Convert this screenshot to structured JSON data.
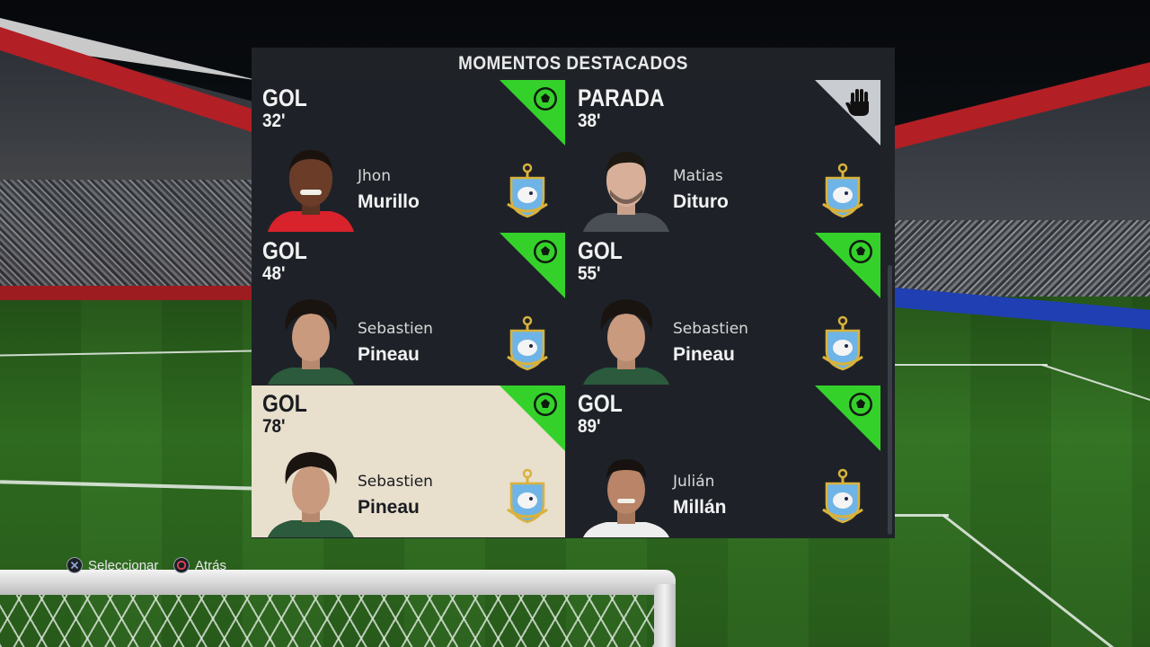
{
  "panel": {
    "title": "MOMENTOS DESTACADOS"
  },
  "highlights": [
    {
      "event": "GOL",
      "minute": "32'",
      "first_name": "Jhon",
      "last_name": "Murillo",
      "type_icon": "soccer-ball-icon",
      "corner_color": "#35d12b",
      "selected": false
    },
    {
      "event": "PARADA",
      "minute": "38'",
      "first_name": "Matias",
      "last_name": "Dituro",
      "type_icon": "goalkeeper-glove-icon",
      "corner_color": "#c9ccd0",
      "selected": false
    },
    {
      "event": "GOL",
      "minute": "48'",
      "first_name": "Sebastien",
      "last_name": "Pineau",
      "type_icon": "soccer-ball-icon",
      "corner_color": "#35d12b",
      "selected": false
    },
    {
      "event": "GOL",
      "minute": "55'",
      "first_name": "Sebastien",
      "last_name": "Pineau",
      "type_icon": "soccer-ball-icon",
      "corner_color": "#35d12b",
      "selected": false
    },
    {
      "event": "GOL",
      "minute": "78'",
      "first_name": "Sebastien",
      "last_name": "Pineau",
      "type_icon": "soccer-ball-icon",
      "corner_color": "#35d12b",
      "selected": true
    },
    {
      "event": "GOL",
      "minute": "89'",
      "first_name": "Julián",
      "last_name": "Millán",
      "type_icon": "soccer-ball-icon",
      "corner_color": "#35d12b",
      "selected": false
    }
  ],
  "hints": {
    "select_label": "Seleccionar",
    "select_icon": "cross-button-icon",
    "back_label": "Atrás",
    "back_icon": "circle-button-icon"
  },
  "colors": {
    "highlight_card": "#e8dfcd",
    "card": "#1e2228",
    "accent_green": "#35d12b"
  }
}
